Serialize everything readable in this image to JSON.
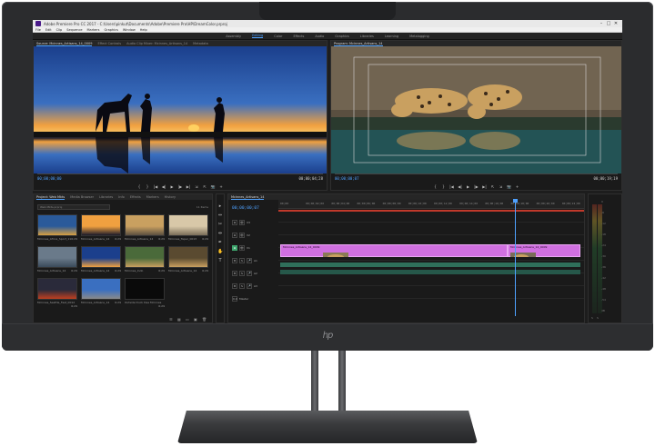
{
  "titlebar": {
    "title": "Adobe Premiere Pro CC 2017 - C:\\Users\\pinkut\\Documents\\Adobe\\Premiere Pro\\HP\\DreamColor.prproj",
    "minimize": "–",
    "maximize": "□",
    "close": "✕"
  },
  "menubar": [
    "File",
    "Edit",
    "Clip",
    "Sequence",
    "Markers",
    "Graphics",
    "Window",
    "Help"
  ],
  "workspaces": [
    {
      "label": "Assembly",
      "active": false
    },
    {
      "label": "Editing",
      "active": true
    },
    {
      "label": "Color",
      "active": false
    },
    {
      "label": "Effects",
      "active": false
    },
    {
      "label": "Audio",
      "active": false
    },
    {
      "label": "Graphics",
      "active": false
    },
    {
      "label": "Libraries",
      "active": false
    },
    {
      "label": "Learning",
      "active": false
    },
    {
      "label": "Metalogging",
      "active": false
    }
  ],
  "source": {
    "tabs": [
      {
        "label": "Source: Mcinnes_Artisans_14_0009",
        "active": true
      },
      {
        "label": "Effect Controls",
        "active": false
      },
      {
        "label": "Audio Clip Mixer: Mcinnes_Artisans_14",
        "active": false
      },
      {
        "label": "Metadata",
        "active": false
      }
    ],
    "timecode_in": "00;00;00;00",
    "timecode_out": "00;00;04;28",
    "transport": [
      "{",
      "}",
      "|◀",
      "◀|",
      "▶",
      "|▶",
      "▶|",
      "⇲",
      "⇱",
      "📷",
      "+"
    ]
  },
  "program": {
    "tabs": [
      {
        "label": "Program: Mcinnes_Artisans_14",
        "active": true
      }
    ],
    "timecode_in": "00;00;00;07",
    "timecode_out": "00;00;19;19",
    "transport": [
      "{",
      "}",
      "|◀",
      "◀|",
      "▶",
      "|▶",
      "▶|",
      "⇱",
      "⇲",
      "📷",
      "+"
    ]
  },
  "project": {
    "tabs": [
      {
        "label": "Project: Web Mkts",
        "active": true
      },
      {
        "label": "Media Browser",
        "active": false
      },
      {
        "label": "Libraries",
        "active": false
      },
      {
        "label": "Info",
        "active": false
      },
      {
        "label": "Effects",
        "active": false
      },
      {
        "label": "Markers",
        "active": false
      },
      {
        "label": "History",
        "active": false
      }
    ],
    "search_placeholder": "Web Mkts.prproj",
    "item_count": "11 Items",
    "clips": [
      {
        "name": "Mcinnes_Africa_Sport_11",
        "duration": "6;29"
      },
      {
        "name": "Mcinnes_Artisans_14",
        "duration": "6;29"
      },
      {
        "name": "Mcinnes_Artisans_14",
        "duration": "6;29"
      },
      {
        "name": "Mcinnes_Taper_0013",
        "duration": "6;29"
      },
      {
        "name": "Mcinnes_Artisans_14",
        "duration": "6;29"
      },
      {
        "name": "Mcinnes_Artisans_14",
        "duration": "6;29"
      },
      {
        "name": "Mcinnes_Indo",
        "duration": "6;29"
      },
      {
        "name": "Mcinnes_Artisans_14",
        "duration": "6;29"
      },
      {
        "name": "Mcinnes_Seattle_Fest_0012",
        "duration": "6;29"
      },
      {
        "name": "Mcinnes_Artisans_14",
        "duration": "6;29"
      },
      {
        "name": "Outside Duck Dee Mcinnes",
        "duration": "6;29"
      }
    ]
  },
  "tools": [
    "▸",
    "⇔",
    "✂",
    "⇹",
    "✒",
    "✋",
    "T"
  ],
  "timeline": {
    "tab": "Mcinnes_Artisans_14",
    "timecode": "00;00;00;07",
    "ruler": [
      "00;00",
      "00;00;02;00",
      "00;00;04;00",
      "00;00;06;00",
      "00;00;08;00",
      "00;00;10;00",
      "00;00;12;00",
      "00;00;14;00",
      "00;00;16;00",
      "00;00;18;00",
      "00;00;20;00",
      "00;00;22;00"
    ],
    "tracks": [
      {
        "name": "V3",
        "buttons": [
          "⊕",
          "👁"
        ]
      },
      {
        "name": "V2",
        "buttons": [
          "⊕",
          "👁"
        ]
      },
      {
        "name": "V1",
        "buttons": [
          "⊕",
          "👁"
        ]
      },
      {
        "name": "A1",
        "buttons": [
          "M",
          "S",
          "🎤"
        ]
      },
      {
        "name": "A2",
        "buttons": [
          "M",
          "S",
          "🎤"
        ]
      },
      {
        "name": "A3",
        "buttons": [
          "M",
          "S",
          "🎤"
        ]
      },
      {
        "name": "Master",
        "buttons": [
          "0.0"
        ]
      }
    ],
    "clip_a_label": "Mcinnes_Artisans_14_0009",
    "clip_b_label": "Mcinnes_Artisans_14_0009"
  },
  "meter": {
    "ticks": [
      "0",
      "-6",
      "-12",
      "-18",
      "-24",
      "-30",
      "-36",
      "-42",
      "-48",
      "-54",
      "dB"
    ],
    "channels": [
      "S",
      "S"
    ]
  },
  "monitor_brand": "hp",
  "colors": {
    "accent_blue": "#4ea1ff",
    "clip_pink": "#d070e0",
    "work_area_red": "#c0392b"
  }
}
